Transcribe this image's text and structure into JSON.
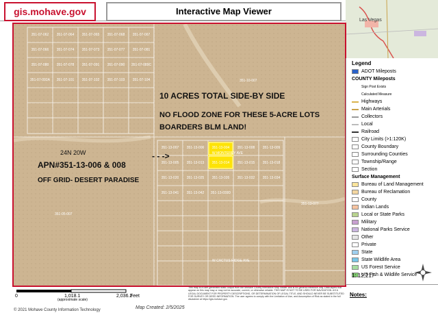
{
  "header": {
    "logo": "gis.mohave.gov",
    "title": "Interactive Map Viewer"
  },
  "overlay": {
    "line1": "10 ACRES TOTAL SIDE-BY SIDE",
    "line2": "NO FLOOD ZONE FOR THESE 5-ACRE LOTS",
    "line3": "BOARDERS BLM LAND!",
    "township": "24N 20W",
    "apn": "APN#351-13-006 & 008",
    "tagline": "OFF GRID- DESERT PARADISE",
    "arrow": "- - ->"
  },
  "overview": {
    "city": "Las Vegas"
  },
  "legend": {
    "title": "Legend",
    "items": [
      {
        "label": "ADOT Mileposts",
        "kind": "check"
      },
      {
        "label": "COUNTY Mileposts",
        "kind": "header"
      },
      {
        "label": "Sign Post Exists",
        "kind": "small"
      },
      {
        "label": "Calculated Measure",
        "kind": "small"
      },
      {
        "label": "Highways",
        "kind": "line",
        "color": "#d9b24a"
      },
      {
        "label": "Main Arterials",
        "kind": "line",
        "color": "#c9a24a"
      },
      {
        "label": "Collectors",
        "kind": "line",
        "color": "#999"
      },
      {
        "label": "Local",
        "kind": "line",
        "color": "#bbb"
      },
      {
        "label": "Railroad",
        "kind": "line",
        "color": "#333"
      },
      {
        "label": "City Limits (>1:120K)",
        "kind": "box",
        "color": "#ffffff"
      },
      {
        "label": "County Boundary",
        "kind": "box",
        "color": "#ffffff"
      },
      {
        "label": "Surrounding Counties",
        "kind": "box",
        "color": "#ffffff"
      },
      {
        "label": "Township/Range",
        "kind": "box",
        "color": "#ffffff"
      },
      {
        "label": "Section",
        "kind": "box",
        "color": "#ffffff"
      },
      {
        "label": "Surface Management",
        "kind": "header"
      },
      {
        "label": "Bureau of Land Management",
        "kind": "swatch",
        "color": "#fbe59c"
      },
      {
        "label": "Bureau of Reclamation",
        "kind": "swatch",
        "color": "#f3d6a0"
      },
      {
        "label": "County",
        "kind": "swatch",
        "color": "#ffffff"
      },
      {
        "label": "Indian Lands",
        "kind": "swatch",
        "color": "#f6c3a0"
      },
      {
        "label": "Local or State Parks",
        "kind": "swatch",
        "color": "#b9d48f"
      },
      {
        "label": "Military",
        "kind": "swatch",
        "color": "#c8a0d0"
      },
      {
        "label": "National Parks Service",
        "kind": "swatch",
        "color": "#cbb6e0"
      },
      {
        "label": "Other",
        "kind": "swatch",
        "color": "#e6e6e6"
      },
      {
        "label": "Private",
        "kind": "swatch",
        "color": "#ffffff"
      },
      {
        "label": "State",
        "kind": "swatch",
        "color": "#9fd0f0"
      },
      {
        "label": "State Wildlife Area",
        "kind": "swatch",
        "color": "#78c6e8"
      },
      {
        "label": "US Forest Service",
        "kind": "swatch",
        "color": "#a6dca0"
      },
      {
        "label": "US Fish & Wildlife Service",
        "kind": "swatch",
        "color": "#7ec86e"
      }
    ],
    "scale": "1: 12,217"
  },
  "scalebar": {
    "t0": "0",
    "t1": "1,018.1",
    "t2": "2,036.2",
    "unit": "Feet",
    "note": "(approximate scale)"
  },
  "footer": {
    "copyright": "© 2021 Mohave County Information Technology",
    "created": "Map Created: 2/5/2025",
    "disclaimer": "This map is a user generated static output from the Mohave County Interactive Map Viewer and is for general reference only. Data layers that appear on this map may or may not be accurate, current, or otherwise reliable. THIS MAP IS NOT TO BE USED FOR NAVIGATION. AS A LEGAL DOCUMENT FOR PROPERTY DESCRIPTIONS, OR DETERMINATION OF LEGAL TITLE, AND SHOULD NEVER BE SUBSTITUTED FOR SURVEY OR DEED INFORMATION. The user agrees to comply with the Limitation of Use, and Assumption of Risk as stated in the full disclaimer at https://gis.mohave.gov",
    "notes": "Notes:"
  },
  "parcels_top": [
    "351-07-062",
    "351-07-064",
    "351-07-065",
    "351-07-068",
    "351-07-067",
    "351-07-066",
    "351-07-074",
    "351-07-073",
    "351-07-077",
    "351-07-081",
    "351-07-080",
    "351-07-078",
    "351-07-091",
    "351-07-090",
    "351-07-089C",
    "351-07-092A",
    "351-07-101",
    "351-07-102",
    "351-07-103",
    "351-07-104"
  ],
  "parcels_main": [
    "351-13-007",
    "351-13-006",
    "351-13-004",
    "351-13-008",
    "351-13-009",
    "351-13-005",
    "351-13-013",
    "351-13-014",
    "351-13-015",
    "351-13-018",
    "351-13-020",
    "351-13-025",
    "351-13-026",
    "351-13-032",
    "351-13-034",
    "351-13-041",
    "351-13-042",
    "351-13-039D"
  ],
  "parcels_other": [
    "351-05-007",
    "351-13-077",
    "351-10-007",
    "351-07-081"
  ],
  "streets": [
    "W MONTEREY AVE",
    "W CACTUS RIDGE AVE",
    "N DIAMOND RD"
  ]
}
